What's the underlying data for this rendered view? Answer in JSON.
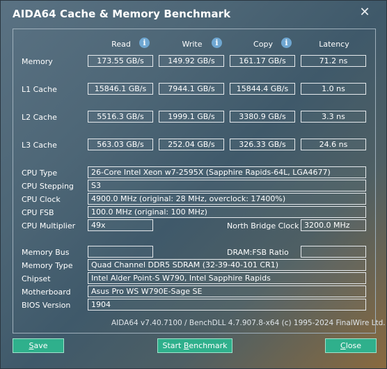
{
  "window": {
    "title": "AIDA64 Cache & Memory Benchmark",
    "close_glyph": "✕"
  },
  "headers": {
    "read": "Read",
    "write": "Write",
    "copy": "Copy",
    "latency": "Latency",
    "info_glyph": "i"
  },
  "rows": {
    "memory": {
      "label": "Memory",
      "read": "173.55 GB/s",
      "write": "149.92 GB/s",
      "copy": "161.17 GB/s",
      "latency": "71.2 ns"
    },
    "l1": {
      "label": "L1 Cache",
      "read": "15846.1 GB/s",
      "write": "7944.1 GB/s",
      "copy": "15844.4 GB/s",
      "latency": "1.0 ns"
    },
    "l2": {
      "label": "L2 Cache",
      "read": "5516.3 GB/s",
      "write": "1999.1 GB/s",
      "copy": "3380.9 GB/s",
      "latency": "3.3 ns"
    },
    "l3": {
      "label": "L3 Cache",
      "read": "563.03 GB/s",
      "write": "252.04 GB/s",
      "copy": "326.33 GB/s",
      "latency": "24.6 ns"
    }
  },
  "cpu": {
    "type_label": "CPU Type",
    "type": "26-Core Intel Xeon w7-2595X  (Sapphire Rapids-64L, LGA4677)",
    "stepping_label": "CPU Stepping",
    "stepping": "S3",
    "clock_label": "CPU Clock",
    "clock": "4900.0 MHz  (original: 28 MHz, overclock: 17400%)",
    "fsb_label": "CPU FSB",
    "fsb": "100.0 MHz  (original: 100 MHz)",
    "multiplier_label": "CPU Multiplier",
    "multiplier": "49x",
    "nb_clock_label": "North Bridge Clock",
    "nb_clock": "3200.0 MHz"
  },
  "system": {
    "mem_bus_label": "Memory Bus",
    "mem_bus": "",
    "dram_fsb_label": "DRAM:FSB Ratio",
    "dram_fsb": "",
    "mem_type_label": "Memory Type",
    "mem_type": "Quad Channel DDR5 SDRAM  (32-39-40-101 CR1)",
    "chipset_label": "Chipset",
    "chipset": "Intel Alder Point-S W790, Intel Sapphire Rapids",
    "motherboard_label": "Motherboard",
    "motherboard": "Asus Pro WS W790E-Sage SE",
    "bios_label": "BIOS Version",
    "bios": "1904"
  },
  "footer": {
    "version_info": "AIDA64 v7.40.7100 / BenchDLL 4.7.907.8-x64  (c) 1995-2024 FinalWire Ltd.",
    "save_first": "S",
    "save_rest": "ave",
    "start_a": "Start ",
    "start_u": "B",
    "start_b": "enchmark",
    "close_first": "C",
    "close_rest": "lose"
  },
  "colors": {
    "button": "#2fb08c",
    "info": "#6fa7d2"
  }
}
